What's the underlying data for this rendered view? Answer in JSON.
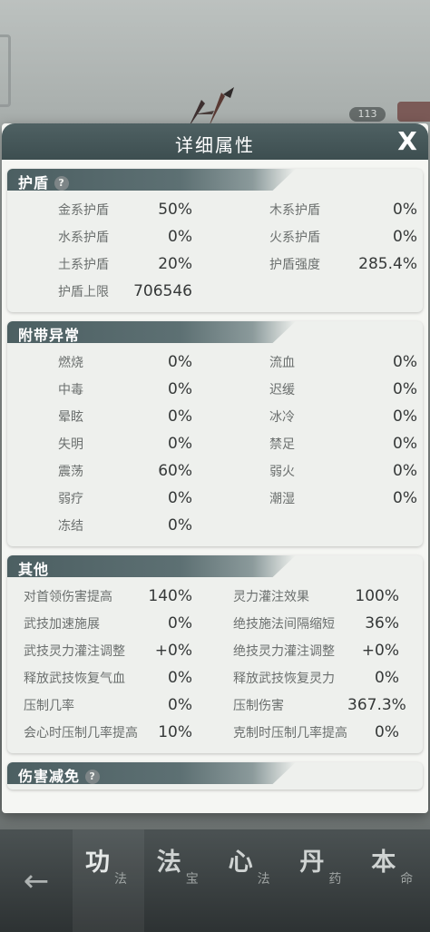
{
  "background": {
    "level_badge": "113"
  },
  "modal": {
    "title": "详细属性",
    "close_label": "X"
  },
  "sections": {
    "shield": {
      "title": "护盾",
      "help": "?",
      "rows": [
        [
          {
            "k": "金系护盾",
            "v": "50%"
          },
          {
            "k": "木系护盾",
            "v": "0%"
          }
        ],
        [
          {
            "k": "水系护盾",
            "v": "0%"
          },
          {
            "k": "火系护盾",
            "v": "0%"
          }
        ],
        [
          {
            "k": "土系护盾",
            "v": "20%"
          },
          {
            "k": "护盾强度",
            "v": "285.4%"
          }
        ],
        [
          {
            "k": "护盾上限",
            "v": "706546"
          }
        ]
      ]
    },
    "status": {
      "title": "附带异常",
      "rows": [
        [
          {
            "k": "燃烧",
            "v": "0%"
          },
          {
            "k": "流血",
            "v": "0%"
          }
        ],
        [
          {
            "k": "中毒",
            "v": "0%"
          },
          {
            "k": "迟缓",
            "v": "0%"
          }
        ],
        [
          {
            "k": "晕眩",
            "v": "0%"
          },
          {
            "k": "冰冷",
            "v": "0%"
          }
        ],
        [
          {
            "k": "失明",
            "v": "0%"
          },
          {
            "k": "禁足",
            "v": "0%"
          }
        ],
        [
          {
            "k": "震荡",
            "v": "60%"
          },
          {
            "k": "弱火",
            "v": "0%"
          }
        ],
        [
          {
            "k": "弱疗",
            "v": "0%"
          },
          {
            "k": "潮湿",
            "v": "0%"
          }
        ],
        [
          {
            "k": "冻结",
            "v": "0%"
          }
        ]
      ]
    },
    "other": {
      "title": "其他",
      "rows": [
        [
          {
            "k": "对首领伤害提高",
            "v": "140%"
          },
          {
            "k": "灵力灌注效果",
            "v": "100%"
          }
        ],
        [
          {
            "k": "武技加速施展",
            "v": "0%"
          },
          {
            "k": "绝技施法间隔缩短",
            "v": "36%"
          }
        ],
        [
          {
            "k": "武技灵力灌注调整",
            "v": "+0%"
          },
          {
            "k": "绝技灵力灌注调整",
            "v": "+0%"
          }
        ],
        [
          {
            "k": "释放武技恢复气血",
            "v": "0%"
          },
          {
            "k": "释放武技恢复灵力",
            "v": "0%"
          }
        ],
        [
          {
            "k": "压制几率",
            "v": "0%"
          },
          {
            "k": "压制伤害",
            "v": "367.3%"
          }
        ],
        [
          {
            "k": "会心时压制几率提高",
            "v": "10%"
          },
          {
            "k": "克制时压制几率提高",
            "v": "0%"
          }
        ]
      ]
    },
    "damage": {
      "title": "伤害减免",
      "help": "?"
    }
  },
  "bottom_nav": {
    "back": "←",
    "tabs": [
      {
        "big": "功",
        "small": "法"
      },
      {
        "big": "法",
        "small": "宝"
      },
      {
        "big": "心",
        "small": "法"
      },
      {
        "big": "丹",
        "small": "药"
      },
      {
        "big": "本",
        "small": "命"
      }
    ]
  }
}
